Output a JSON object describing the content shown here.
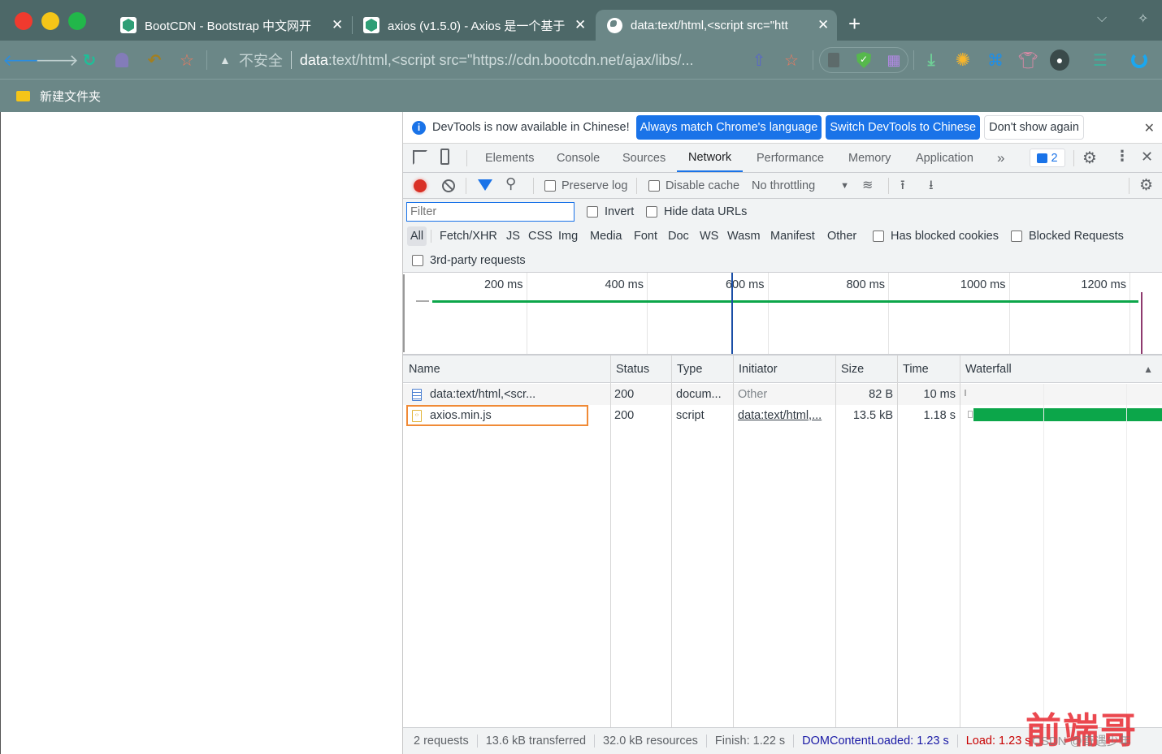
{
  "window": {
    "traffic_lights": [
      "#f03a2e",
      "#f5c518",
      "#22b74a"
    ],
    "tabs": [
      {
        "title": "BootCDN - Bootstrap 中文网开",
        "favicon": "bootcdn-icon",
        "active": false
      },
      {
        "title": "axios (v1.5.0) - Axios 是一个基于",
        "favicon": "bootcdn-icon",
        "active": false
      },
      {
        "title": "data:text/html,<script src=\"htt",
        "favicon": "globe-icon",
        "active": true
      }
    ],
    "new_tab_label": "+",
    "close_glyph": "✕"
  },
  "toolbar": {
    "security_label": "不安全",
    "url_host": "data",
    "url_rest": ":text/html,<script src=\"https://cdn.bootcdn.net/ajax/libs/..."
  },
  "bookmarks": [
    {
      "label": "新建文件夹",
      "icon": "folder-icon"
    }
  ],
  "devtools": {
    "infobar": {
      "message": "DevTools is now available in Chinese!",
      "btn_match": "Always match Chrome's language",
      "btn_switch": "Switch DevTools to Chinese",
      "btn_dont_show": "Don't show again"
    },
    "tabs": [
      "Elements",
      "Console",
      "Sources",
      "Network",
      "Performance",
      "Memory",
      "Application"
    ],
    "active_tab": "Network",
    "more_tabs": "»",
    "issues_count": "2",
    "network_toolbar": {
      "preserve_log": "Preserve log",
      "disable_cache": "Disable cache",
      "throttling": "No throttling"
    },
    "filter": {
      "placeholder": "Filter",
      "invert": "Invert",
      "hide_data_urls": "Hide data URLs",
      "types": [
        "All",
        "Fetch/XHR",
        "JS",
        "CSS",
        "Img",
        "Media",
        "Font",
        "Doc",
        "WS",
        "Wasm",
        "Manifest",
        "Other"
      ],
      "has_blocked_cookies": "Has blocked cookies",
      "blocked_requests": "Blocked Requests",
      "third_party": "3rd-party requests"
    },
    "overview": {
      "ticks": [
        "200 ms",
        "400 ms",
        "600 ms",
        "800 ms",
        "1000 ms",
        "1200 ms"
      ],
      "tick_values_ms": [
        200,
        400,
        600,
        800,
        1000,
        1200
      ],
      "dom_content_loaded_ms": 1230,
      "load_ms": 1230,
      "blue_marker_ms": 540,
      "range_ms": [
        0,
        1260
      ]
    },
    "columns": [
      "Name",
      "Status",
      "Type",
      "Initiator",
      "Size",
      "Time",
      "Waterfall"
    ],
    "sort_glyph": "▲",
    "rows": [
      {
        "name": "data:text/html,<scr...",
        "status": "200",
        "type": "docum...",
        "initiator": "Other",
        "size": "82 B",
        "time": "10 ms",
        "icon": "document-icon",
        "selected": false
      },
      {
        "name": "axios.min.js",
        "status": "200",
        "type": "script",
        "initiator": "data:text/html,...",
        "size": "13.5 kB",
        "time": "1.18 s",
        "icon": "script-icon",
        "selected": true
      }
    ],
    "status_bar": {
      "requests": "2 requests",
      "transferred": "13.6 kB transferred",
      "resources": "32.0 kB resources",
      "finish": "Finish: 1.22 s",
      "dom_content_loaded": "DOMContentLoaded: 1.23 s",
      "load": "Load: 1.23 s"
    },
    "colors": {
      "accent": "#1a73e8",
      "waterfall_bar": "#0ca64a",
      "dcl": "#1a1aa6",
      "load": "#c80000",
      "selected_outline": "#f08a36"
    }
  },
  "watermark": {
    "title": "前端哥",
    "credit": "CSDN @奇遇少年"
  }
}
